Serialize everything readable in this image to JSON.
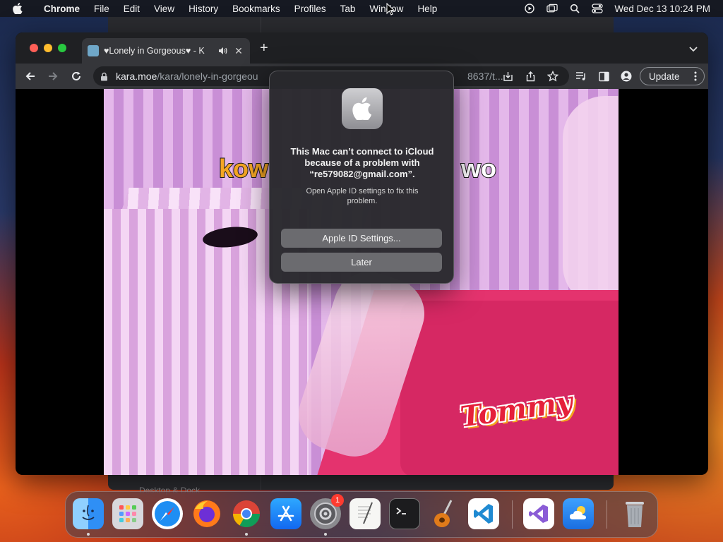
{
  "menubar": {
    "app_name": "Chrome",
    "items": [
      "File",
      "Edit",
      "View",
      "History",
      "Bookmarks",
      "Profiles",
      "Tab",
      "Window",
      "Help"
    ],
    "clock": "Wed Dec 13  10:24 PM"
  },
  "background_window": {
    "sidebar_label": "Desktop & Dock"
  },
  "browser": {
    "tab": {
      "title": "♥Lonely in Gorgeous♥ - K",
      "favicon": "karaoke-site-icon"
    },
    "omnibox": {
      "host": "kara.moe",
      "path": "/kara/lonely-in-gorgeou",
      "tail": "8637/t..."
    },
    "update_label": "Update"
  },
  "video": {
    "caption_left": "kow",
    "caption_right": "wo",
    "sticker_text": "Tommy"
  },
  "dialog": {
    "title": "This Mac can’t connect to iCloud because of a problem with “re579082@gmail.com”.",
    "message": "Open Apple ID settings to fix this problem.",
    "primary_button": "Apple ID Settings...",
    "secondary_button": "Later"
  },
  "dock": {
    "apps": [
      "Finder",
      "Launchpad",
      "Safari",
      "Firefox",
      "Google Chrome",
      "App Store",
      "System Settings",
      "TextEdit",
      "Terminal",
      "GarageBand",
      "Visual Studio Code",
      "Visual Studio",
      "Weather",
      "Trash"
    ],
    "settings_badge": "1"
  },
  "colors": {
    "accent_red": "#fe5f57",
    "accent_yellow": "#febc2e",
    "accent_green": "#28c840",
    "badge": "#ff3b30"
  }
}
